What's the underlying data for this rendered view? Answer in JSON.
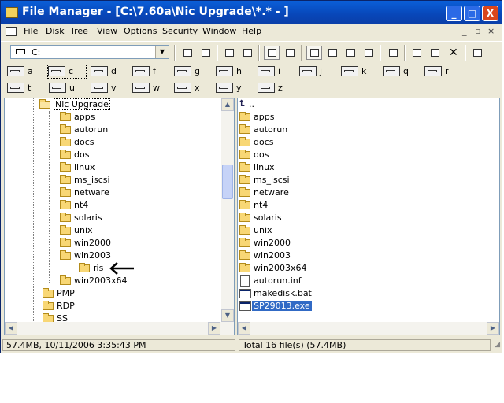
{
  "window": {
    "title": "File Manager - [C:\\7.60a\\Nic Upgrade\\*.* - ]",
    "controls": [
      "_",
      "□",
      "X"
    ]
  },
  "menu": {
    "items": [
      {
        "label": "File",
        "u": "F",
        "rest": "ile"
      },
      {
        "label": "Disk",
        "u": "D",
        "rest": "isk"
      },
      {
        "label": "Tree",
        "u": "T",
        "rest": "ree"
      },
      {
        "label": "View",
        "u": "V",
        "rest": "iew"
      },
      {
        "label": "Options",
        "u": "O",
        "rest": "ptions"
      },
      {
        "label": "Security",
        "u": "S",
        "rest": "ecurity"
      },
      {
        "label": "Window",
        "u": "W",
        "rest": "indow"
      },
      {
        "label": "Help",
        "u": "H",
        "rest": "elp"
      }
    ],
    "mdi_controls": [
      "_",
      "▫",
      "×"
    ]
  },
  "toolbar": {
    "drive_select_value": "C:"
  },
  "drives": [
    "a",
    "c",
    "d",
    "f",
    "g",
    "h",
    "i",
    "j",
    "k",
    "q",
    "r",
    "t",
    "u",
    "v",
    "w",
    "x",
    "y",
    "z"
  ],
  "tree": {
    "root": "Nic Upgrade",
    "items": [
      "apps",
      "autorun",
      "docs",
      "dos",
      "linux",
      "ms_iscsi",
      "netware",
      "nt4",
      "solaris",
      "unix",
      "win2000",
      "win2003",
      "ris",
      "win2003x64",
      "PMP",
      "RDP",
      "SS"
    ]
  },
  "files": {
    "parent": "..",
    "items": [
      {
        "name": "apps",
        "type": "folder"
      },
      {
        "name": "autorun",
        "type": "folder"
      },
      {
        "name": "docs",
        "type": "folder"
      },
      {
        "name": "dos",
        "type": "folder"
      },
      {
        "name": "linux",
        "type": "folder"
      },
      {
        "name": "ms_iscsi",
        "type": "folder"
      },
      {
        "name": "netware",
        "type": "folder"
      },
      {
        "name": "nt4",
        "type": "folder"
      },
      {
        "name": "solaris",
        "type": "folder"
      },
      {
        "name": "unix",
        "type": "folder"
      },
      {
        "name": "win2000",
        "type": "folder"
      },
      {
        "name": "win2003",
        "type": "folder"
      },
      {
        "name": "win2003x64",
        "type": "folder"
      },
      {
        "name": "autorun.inf",
        "type": "file"
      },
      {
        "name": "makedisk.bat",
        "type": "exe"
      },
      {
        "name": "SP29013.exe",
        "type": "exe",
        "selected": true
      }
    ]
  },
  "status": {
    "left": "57.4MB, 10/11/2006 3:35:43 PM",
    "right": "Total 16 file(s) (57.4MB)"
  },
  "icons": {
    "title": "file-cabinet-icon",
    "folder": "folder-icon",
    "drive": "drive-icon",
    "annotation": "arrow-left-icon"
  },
  "colors": {
    "titlebar": "#0a5fd8",
    "selection": "#316ac5",
    "folder": "#f8d775"
  }
}
